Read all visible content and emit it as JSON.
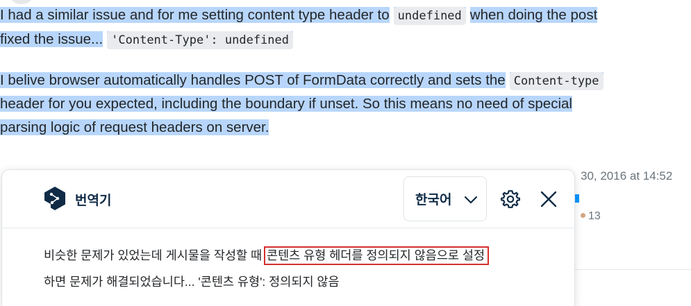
{
  "answer": {
    "line1": {
      "text_a": "I had a similar issue and for me setting content type header to",
      "code_a": "undefined",
      "text_b": "when doing the post"
    },
    "line2": {
      "text_a": "fixed the issue...",
      "code_a": "'Content-Type': undefined"
    },
    "line3": {
      "text_a": "I belive browser automatically handles POST of FormData correctly and sets the",
      "code_a": "Content-type"
    },
    "line4": {
      "text_a": "header for you expected, including the boundary if unset. So this means no need of special"
    },
    "line5": {
      "text_a": "parsing logic of request headers on server."
    }
  },
  "meta": {
    "date": "30, 2016 at 14:52",
    "bronze_badges": "13"
  },
  "translator": {
    "title": "번역기",
    "target_language": "한국어",
    "translation": {
      "line1_pre": "비슷한 문제가 있었는데 게시물을 작성할 때 ",
      "line1_marked": "콘텐츠 유형 헤더를 정의되지 않음으로 설정",
      "line2": "하면 문제가 해결되었습니다... '콘텐츠 유형': 정의되지 않음"
    }
  },
  "colors": {
    "selection": "#b8d6fb",
    "code_bg": "#e9ebee",
    "translator_navy": "#0f2b46",
    "mark_outline": "#d32f2f",
    "bronze": "#d1a684"
  },
  "icons": [
    "deepl-logo-icon",
    "chevron-down-icon",
    "gear-icon",
    "close-icon"
  ]
}
